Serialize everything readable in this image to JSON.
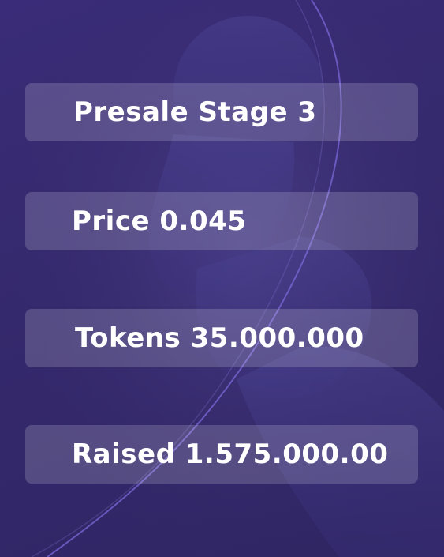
{
  "presale_cards": [
    {
      "label": "Presale Stage 3"
    },
    {
      "label": "Price 0.045"
    },
    {
      "label": "Tokens 35.000.000"
    },
    {
      "label": "Raised 1.575.000.00"
    }
  ],
  "colors": {
    "background_top": "#3a2c78",
    "background_bottom": "#2f2563",
    "card_fill": "rgba(255,255,255,0.17)",
    "text": "#ffffff",
    "accent_curve": "#7b68d8"
  }
}
